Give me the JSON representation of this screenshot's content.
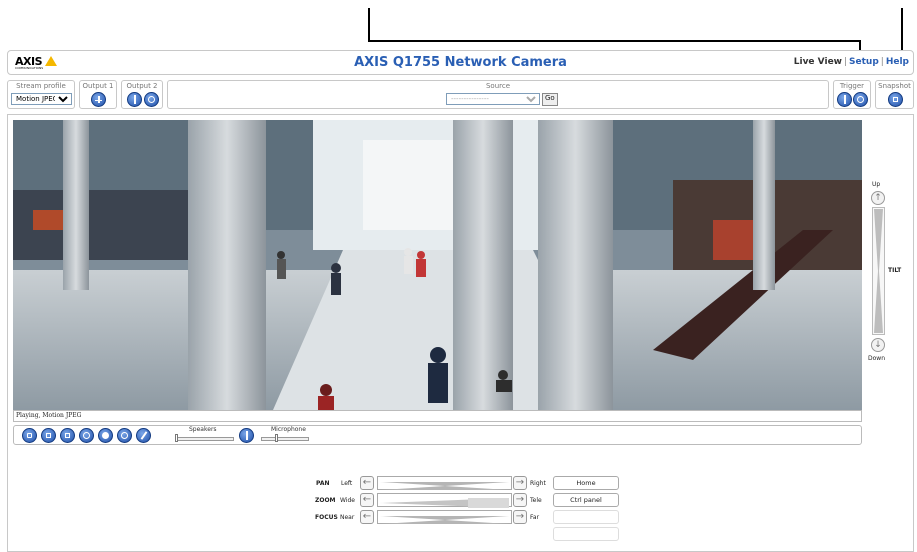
{
  "header": {
    "logo_text": "AXIS",
    "logo_subtext": "COMMUNICATIONS",
    "title": "AXIS Q1755 Network Camera",
    "nav": {
      "live_view": "Live View",
      "setup": "Setup",
      "help": "Help",
      "separator": "|"
    }
  },
  "toolbar": {
    "stream_profile": {
      "label": "Stream profile",
      "value": "Motion JPEG"
    },
    "output1": {
      "label": "Output 1"
    },
    "output2": {
      "label": "Output 2"
    },
    "source": {
      "label": "Source",
      "value": "---------------",
      "go": "Go"
    },
    "trigger": {
      "label": "Trigger"
    },
    "snapshot": {
      "label": "Snapshot"
    }
  },
  "video": {
    "status": "Playing, Motion JPEG"
  },
  "player_controls": {
    "speakers_label": "Speakers",
    "microphone_label": "Microphone",
    "speakers_level": 0.0,
    "microphone_level": 0.3
  },
  "tilt": {
    "label": "TILT",
    "up": "Up",
    "down": "Down"
  },
  "ptz": {
    "pan": {
      "label": "PAN",
      "left": "Left",
      "right": "Right"
    },
    "zoom": {
      "label": "ZOOM",
      "left": "Wide",
      "right": "Tele"
    },
    "focus": {
      "label": "FOCUS",
      "left": "Near",
      "right": "Far"
    },
    "home_button": "Home",
    "ctrl_panel_button": "Ctrl panel"
  },
  "colors": {
    "accent": "#2a5fb4",
    "logo_yellow": "#f5b800",
    "button_blue": "#1f4fa8"
  },
  "icons": [
    "output-pulse-icon",
    "output-toggle-icon",
    "trigger-icon",
    "snapshot-camera-icon",
    "stop-icon",
    "snapshot-icon",
    "fullscreen-icon",
    "ptz-icon",
    "record-icon",
    "audio-icon",
    "speaker-icon",
    "microphone-icon",
    "arrow-up-icon",
    "arrow-down-icon",
    "arrow-left-icon",
    "arrow-right-icon"
  ]
}
